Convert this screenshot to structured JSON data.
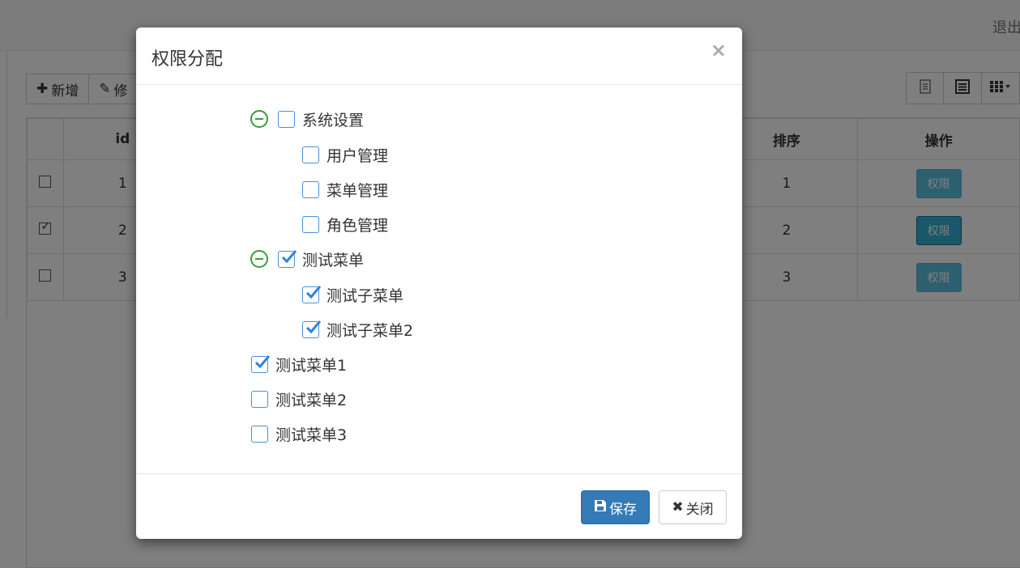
{
  "page": {
    "logout_label": "退出",
    "toolbar": {
      "add_label": "新增",
      "edit_label": "修"
    },
    "table": {
      "headers": [
        "id",
        "排序",
        "操作"
      ],
      "rows": [
        {
          "id": "1",
          "order": "1",
          "action": "权限",
          "checked": false
        },
        {
          "id": "2",
          "order": "2",
          "action": "权限",
          "checked": true
        },
        {
          "id": "3",
          "order": "3",
          "action": "权限",
          "checked": false
        }
      ]
    }
  },
  "modal": {
    "title": "权限分配",
    "close_symbol": "×",
    "tree": [
      {
        "label": "系统设置",
        "checked": false,
        "expanded": true
      },
      {
        "label": "用户管理",
        "checked": false
      },
      {
        "label": "菜单管理",
        "checked": false
      },
      {
        "label": "角色管理",
        "checked": false
      },
      {
        "label": "测试菜单",
        "checked": true,
        "expanded": true
      },
      {
        "label": "测试子菜单",
        "checked": true
      },
      {
        "label": "测试子菜单2",
        "checked": true
      },
      {
        "label": "测试菜单1",
        "checked": true
      },
      {
        "label": "测试菜单2",
        "checked": false
      },
      {
        "label": "测试菜单3",
        "checked": false
      }
    ],
    "save_label": "保存",
    "close_label": "关闭"
  },
  "colors": {
    "primary": "#337ab7",
    "info": "#5bc0de",
    "tree_toggle": "#3c9a3c",
    "checkbox": "#4a90d9"
  }
}
